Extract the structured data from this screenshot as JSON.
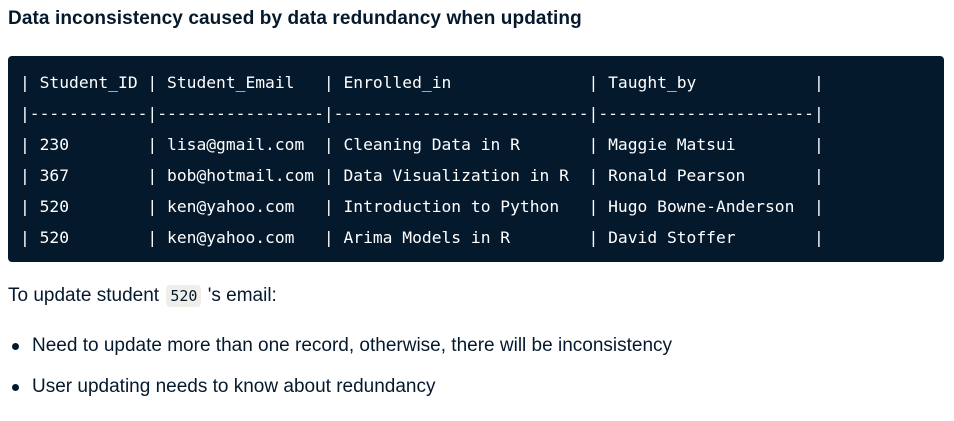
{
  "heading": "Data inconsistency caused by data redundancy when updating",
  "table": {
    "lines": [
      "| Student_ID | Student_Email   | Enrolled_in              | Taught_by            |",
      "|------------|-----------------|--------------------------|----------------------|",
      "| 230        | lisa@gmail.com  | Cleaning Data in R       | Maggie Matsui        |",
      "| 367        | bob@hotmail.com | Data Visualization in R  | Ronald Pearson       |",
      "| 520        | ken@yahoo.com   | Introduction to Python   | Hugo Bowne-Anderson  |",
      "| 520        | ken@yahoo.com   | Arima Models in R        | David Stoffer        |"
    ]
  },
  "intro": {
    "before": "To update student",
    "code": "520",
    "after": "'s email:"
  },
  "bullets": [
    "Need to update more than one record, otherwise, there will be inconsistency",
    "User updating needs to know about redundancy"
  ],
  "colors": {
    "code_background": "#05192d",
    "inline_code_background": "#efeee9",
    "text": "#05192d"
  }
}
